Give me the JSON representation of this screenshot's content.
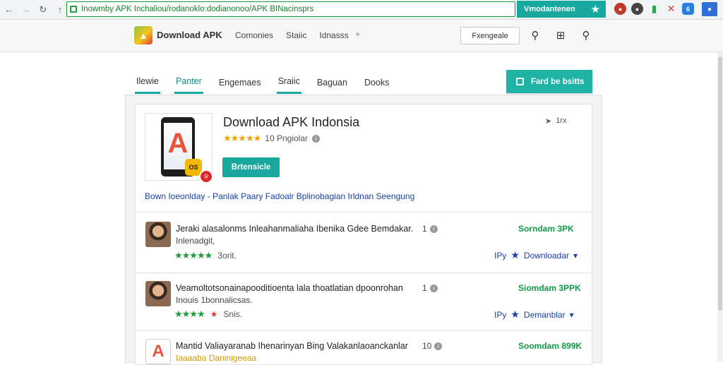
{
  "browser": {
    "url": "Inowmby APK Inchaliou/rodanoklo:dodianonoo/APK BINacinsprs",
    "cta_label": "Vmodantenen",
    "extension_badge": "6"
  },
  "header": {
    "logo_text": "Download APK",
    "nav": [
      "Comonies",
      "Staiic",
      "Idnasss"
    ],
    "button_label": "Fxengeale"
  },
  "tabs": {
    "items": [
      "Ilewie",
      "Panter",
      "Engemaes",
      "Sraiic",
      "Baguan",
      "Dooks"
    ],
    "cta_label": "Fard be bsitts"
  },
  "app": {
    "title": "Download APK Indonsia",
    "rating_stars": "★★★★★",
    "rating_text": "10 Pngiolar",
    "install_label": "Brtensicle",
    "meta": "1rx",
    "thumb_letter": "A",
    "badge_text": "OS",
    "tags": "Bown Ioeonlday - Panlak  Paary  Fadoalr  Bplinobagian  Irldnan  Seengung"
  },
  "rows": [
    {
      "title": "Jeraki alasalonms Inleahanmaliaha Ibenika Gdee Bemdakar.",
      "sub": "Inlenadgit,",
      "stars": "★★★★★",
      "rating_text": "3orit.",
      "count": "1",
      "download": "Sorndam 3PK",
      "actions": "Downloadar",
      "actions_prefix": "IPy",
      "avatar": "face"
    },
    {
      "title": "Veamoltotsonainapooditioenta lala thoatlatian dpoonrohan",
      "sub": "Inouis 1bonnalicsas.",
      "stars": "★★★★",
      "rating_text": "Snis.",
      "count": "1",
      "download": "Siomdam 3PPK",
      "actions": "Demanblar",
      "actions_prefix": "IPy",
      "avatar": "face"
    },
    {
      "title": "Mantid Valiayaranab Ihenarinyan Bing Valakanlaoanckanlar",
      "sub": "Iaaaaba Daninigeeaa",
      "stars": "",
      "rating_text": "",
      "count": "10",
      "download": "Soomdam 899K",
      "actions": "",
      "actions_prefix": "",
      "avatar": "app"
    }
  ],
  "colors": {
    "accent": "#17a8a0",
    "link": "#1a3fa8",
    "download": "#129a48",
    "star": "#f0a500",
    "star_green": "#1a9c3a"
  }
}
